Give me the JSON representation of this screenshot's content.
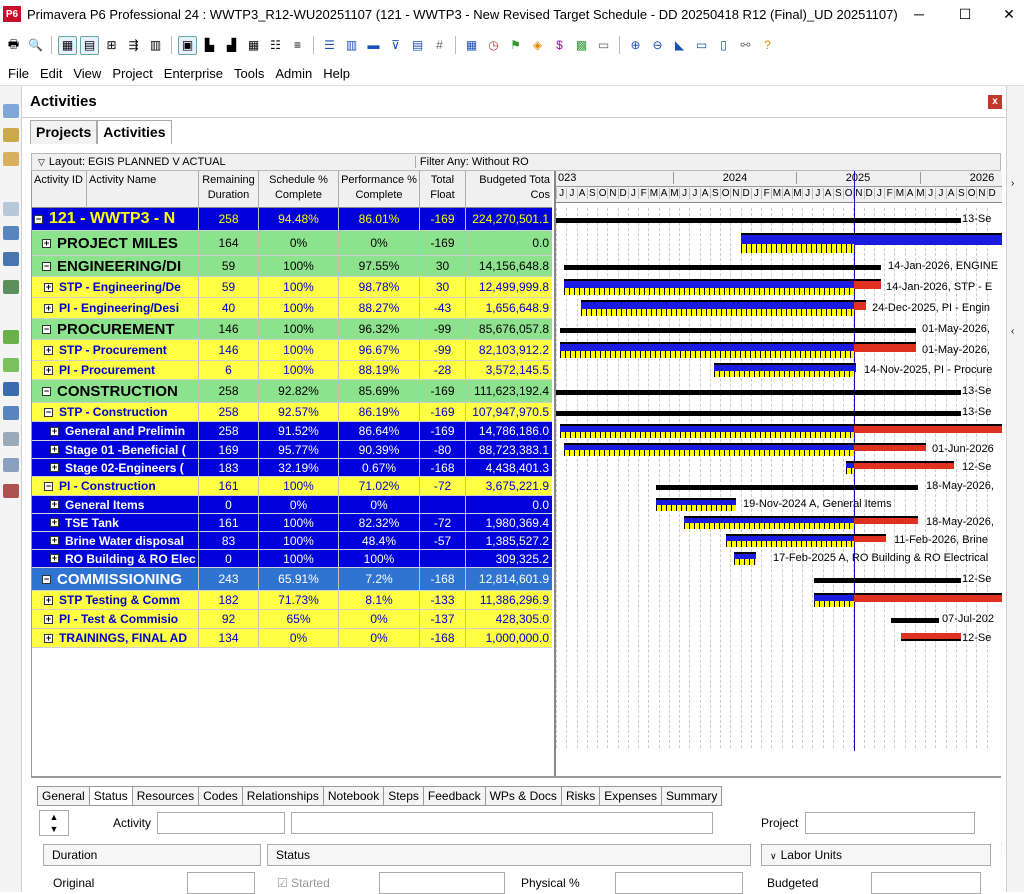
{
  "window": {
    "title": "Primavera P6 Professional 24 : WWTP3_R12-WU20251107 (121 - WWTP3 - New Revised Target Schedule - DD 20250418 R12 (Final)_UD 20251107)",
    "logo": "P6",
    "minimize": "─",
    "maximize": "☐"
  },
  "menu": [
    "File",
    "Edit",
    "View",
    "Project",
    "Enterprise",
    "Tools",
    "Admin",
    "Help"
  ],
  "activities_panel": {
    "title": "Activities",
    "close": "x",
    "tabs": [
      "Projects",
      "Activities"
    ],
    "layout_label": "Layout: EGIS PLANNED V ACTUAL",
    "filter_label": "Filter Any: Without RO"
  },
  "columns": {
    "id": "Activity ID",
    "name": "Activity Name",
    "rem": "Remaining Duration",
    "sched": "Schedule % Complete",
    "perf": "Performance % Complete",
    "tf": "Total Float",
    "budget": "Budgeted Tota Cos"
  },
  "rows": [
    {
      "name": "121 - WWTP3 - N",
      "rem": "258",
      "sched": "94.48%",
      "perf": "86.01%",
      "tf": "-169",
      "budget": "224,270,501.1",
      "bg": "#0000dd",
      "fg": "#ffff00",
      "level": 0,
      "exp": "−",
      "big": true
    },
    {
      "name": "PROJECT MILES",
      "rem": "164",
      "sched": "0%",
      "perf": "0%",
      "tf": "-169",
      "budget": "0.0",
      "bg": "#8de38d",
      "fg": "#000000",
      "level": 1,
      "exp": "+",
      "big": true
    },
    {
      "name": "ENGINEERING/DI",
      "rem": "59",
      "sched": "100%",
      "perf": "97.55%",
      "tf": "30",
      "budget": "14,156,648.8",
      "bg": "#8de38d",
      "fg": "#000000",
      "level": 1,
      "exp": "−",
      "big": true
    },
    {
      "name": "STP - Engineering/De",
      "rem": "59",
      "sched": "100%",
      "perf": "98.78%",
      "tf": "30",
      "budget": "12,499,999.8",
      "bg": "#ffff44",
      "fg": "#0000cc",
      "level": 2,
      "exp": "+",
      "big": false
    },
    {
      "name": "PI - Engineering/Desi",
      "rem": "40",
      "sched": "100%",
      "perf": "88.27%",
      "tf": "-43",
      "budget": "1,656,648.9",
      "bg": "#ffff44",
      "fg": "#0000cc",
      "level": 2,
      "exp": "+",
      "big": false
    },
    {
      "name": "PROCUREMENT",
      "rem": "146",
      "sched": "100%",
      "perf": "96.32%",
      "tf": "-99",
      "budget": "85,676,057.8",
      "bg": "#8de38d",
      "fg": "#000000",
      "level": 1,
      "exp": "−",
      "big": true
    },
    {
      "name": "STP - Procurement",
      "rem": "146",
      "sched": "100%",
      "perf": "96.67%",
      "tf": "-99",
      "budget": "82,103,912.2",
      "bg": "#ffff44",
      "fg": "#0000cc",
      "level": 2,
      "exp": "+",
      "big": false
    },
    {
      "name": "PI - Procurement",
      "rem": "6",
      "sched": "100%",
      "perf": "88.19%",
      "tf": "-28",
      "budget": "3,572,145.5",
      "bg": "#ffff44",
      "fg": "#0000cc",
      "level": 2,
      "exp": "+",
      "big": false
    },
    {
      "name": "CONSTRUCTION",
      "rem": "258",
      "sched": "92.82%",
      "perf": "85.69%",
      "tf": "-169",
      "budget": "111,623,192.4",
      "bg": "#8de38d",
      "fg": "#000000",
      "level": 1,
      "exp": "−",
      "big": true
    },
    {
      "name": "STP - Construction",
      "rem": "258",
      "sched": "92.57%",
      "perf": "86.19%",
      "tf": "-169",
      "budget": "107,947,970.5",
      "bg": "#ffff44",
      "fg": "#0000cc",
      "level": 2,
      "exp": "−",
      "big": false
    },
    {
      "name": "General and Prelimin",
      "rem": "258",
      "sched": "91.52%",
      "perf": "86.64%",
      "tf": "-169",
      "budget": "14,786,186.0",
      "bg": "#0000dd",
      "fg": "#ffffff",
      "level": 3,
      "exp": "+",
      "big": false
    },
    {
      "name": "Stage 01 -Beneficial (",
      "rem": "169",
      "sched": "95.77%",
      "perf": "90.39%",
      "tf": "-80",
      "budget": "88,723,383.1",
      "bg": "#0000dd",
      "fg": "#ffffff",
      "level": 3,
      "exp": "+",
      "big": false
    },
    {
      "name": "Stage 02-Engineers (",
      "rem": "183",
      "sched": "32.19%",
      "perf": "0.67%",
      "tf": "-168",
      "budget": "4,438,401.3",
      "bg": "#0000dd",
      "fg": "#ffffff",
      "level": 3,
      "exp": "+",
      "big": false
    },
    {
      "name": "PI - Construction",
      "rem": "161",
      "sched": "100%",
      "perf": "71.02%",
      "tf": "-72",
      "budget": "3,675,221.9",
      "bg": "#ffff44",
      "fg": "#0000cc",
      "level": 2,
      "exp": "−",
      "big": false
    },
    {
      "name": "General Items",
      "rem": "0",
      "sched": "0%",
      "perf": "0%",
      "tf": "",
      "budget": "0.0",
      "bg": "#0000dd",
      "fg": "#ffffff",
      "level": 3,
      "exp": "+",
      "big": false
    },
    {
      "name": "TSE Tank",
      "rem": "161",
      "sched": "100%",
      "perf": "82.32%",
      "tf": "-72",
      "budget": "1,980,369.4",
      "bg": "#0000dd",
      "fg": "#ffffff",
      "level": 3,
      "exp": "+",
      "big": false
    },
    {
      "name": "Brine Water disposal",
      "rem": "83",
      "sched": "100%",
      "perf": "48.4%",
      "tf": "-57",
      "budget": "1,385,527.2",
      "bg": "#0000dd",
      "fg": "#ffffff",
      "level": 3,
      "exp": "+",
      "big": false
    },
    {
      "name": "RO Building & RO Elec",
      "rem": "0",
      "sched": "100%",
      "perf": "100%",
      "tf": "",
      "budget": "309,325.2",
      "bg": "#0000dd",
      "fg": "#ffffff",
      "level": 3,
      "exp": "+",
      "big": false
    },
    {
      "name": "COMMISSIONING",
      "rem": "243",
      "sched": "65.91%",
      "perf": "7.2%",
      "tf": "-168",
      "budget": "12,814,601.9",
      "bg": "#2f74d0",
      "fg": "#ffffff",
      "level": 1,
      "exp": "−",
      "big": true
    },
    {
      "name": "STP Testing & Comm",
      "rem": "182",
      "sched": "71.73%",
      "perf": "8.1%",
      "tf": "-133",
      "budget": "11,386,296.9",
      "bg": "#ffff44",
      "fg": "#0000cc",
      "level": 2,
      "exp": "+",
      "big": false
    },
    {
      "name": "PI - Test & Commisio",
      "rem": "92",
      "sched": "65%",
      "perf": "0%",
      "tf": "-137",
      "budget": "428,305.0",
      "bg": "#ffff44",
      "fg": "#0000cc",
      "level": 2,
      "exp": "+",
      "big": false
    },
    {
      "name": "TRAININGS, FINAL AD",
      "rem": "134",
      "sched": "0%",
      "perf": "0%",
      "tf": "-168",
      "budget": "1,000,000.0",
      "bg": "#ffff44",
      "fg": "#0000cc",
      "level": 2,
      "exp": "+",
      "big": false
    }
  ],
  "gantt": {
    "years": [
      "023",
      "2024",
      "2025",
      "2026"
    ],
    "months": "JJASONDJFMAMJJASONDJFMAMJJASONDJFMAMJJASOND",
    "labels": [
      "13-Se",
      "14-Jan-2026, ENGINE",
      "14-Jan-2026, STP - E",
      "24-Dec-2025, PI - Engin",
      "01-May-2026,",
      "01-May-2026,",
      "14-Nov-2025, PI - Procure",
      "13-Se",
      "13-Se",
      "01-Jun-2026",
      "12-Se",
      "18-May-2026,",
      "19-Nov-2024 A, General Items",
      "18-May-2026,",
      "11-Feb-2026, Brine",
      "17-Feb-2025 A, RO Building & RO Electrical",
      "12-Se",
      "07-Jul-202",
      "12-Se"
    ]
  },
  "bottom_panel": {
    "tabs": [
      "General",
      "Status",
      "Resources",
      "Codes",
      "Relationships",
      "Notebook",
      "Steps",
      "Feedback",
      "WPs & Docs",
      "Risks",
      "Expenses",
      "Summary"
    ],
    "activity_label": "Activity",
    "project_label": "Project",
    "duration_label": "Duration",
    "status_label": "Status",
    "labor_label": "Labor Units",
    "original_label": "Original",
    "started_label": "Started",
    "physical_label": "Physical %",
    "budgeted_label": "Budgeted"
  }
}
